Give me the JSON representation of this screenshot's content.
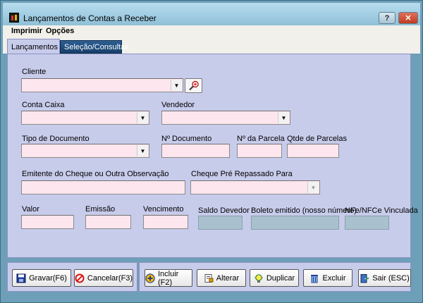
{
  "window": {
    "title": "Lançamentos de Contas a Receber",
    "help_label": "?",
    "close_label": "✕"
  },
  "menu": {
    "items": [
      "Imprimir",
      "Opções"
    ]
  },
  "tabs": {
    "active": "Lançamentos",
    "other": "Seleção/Consultas"
  },
  "form": {
    "cliente": "Cliente",
    "conta_caixa": "Conta Caixa",
    "vendedor": "Vendedor",
    "tipo_documento": "Tipo de Documento",
    "num_documento": "Nº Documento",
    "num_parcela": "Nº da Parcela",
    "qtde_parcelas": "Qtde de Parcelas",
    "emitente": "Emitente do Cheque ou Outra Observação",
    "cheque_repassado": "Cheque Pré Repassado Para",
    "valor": "Valor",
    "emissao": "Emissão",
    "vencimento": "Vencimento",
    "saldo_devedor": "Saldo Devedor",
    "boleto": "Boleto emitido (nosso número)",
    "nfe": "NFe/NFCe Vinculada"
  },
  "buttons": {
    "gravar": "Gravar(F6)",
    "cancelar": "Cancelar(F3)",
    "incluir": "Incluir (F2)",
    "alterar": "Alterar",
    "duplicar": "Duplicar",
    "excluir": "Excluir",
    "sair": "Sair (ESC)"
  },
  "colors": {
    "panel": "#c8cceb",
    "field": "#fde6ee",
    "readonly_field": "#a9c1ce",
    "tab_inactive": "#1f4b7d"
  }
}
